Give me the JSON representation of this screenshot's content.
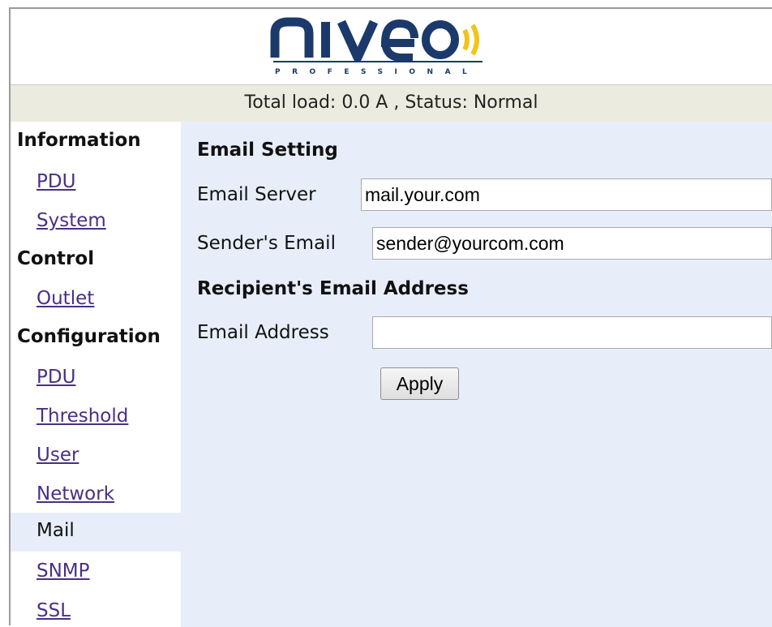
{
  "brand": {
    "logo_text": "niveo",
    "logo_subtitle": "PROFESSIONAL",
    "colors": {
      "navy": "#1b3a6b",
      "yellow": "#f2c418"
    }
  },
  "status": {
    "text": "Total load: 0.0 A , Status: Normal"
  },
  "sidebar": {
    "sections": [
      {
        "heading": "Information",
        "items": [
          "PDU",
          "System"
        ]
      },
      {
        "heading": "Control",
        "items": [
          "Outlet"
        ]
      },
      {
        "heading": "Configuration",
        "items": [
          "PDU",
          "Threshold",
          "User",
          "Network",
          "Mail",
          "SNMP",
          "SSL"
        ]
      }
    ],
    "active_item": "Mail"
  },
  "main": {
    "email_setting_title": "Email Setting",
    "email_server": {
      "label": "Email Server",
      "value": "mail.your.com"
    },
    "sender_email": {
      "label": "Sender's Email",
      "value": "sender@yourcom.com"
    },
    "recipient_title": "Recipient's Email Address",
    "email_address": {
      "label": "Email Address",
      "value": ""
    },
    "apply_label": "Apply"
  }
}
